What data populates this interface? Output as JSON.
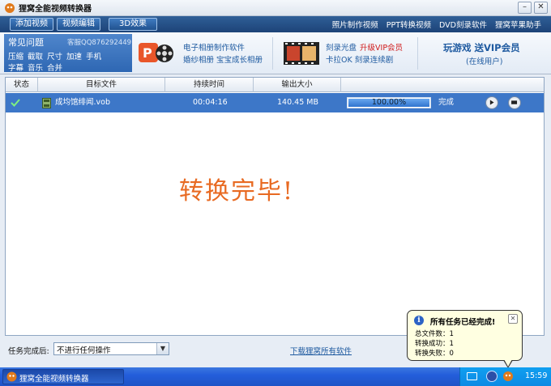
{
  "window": {
    "title": "狸窝全能视频转换器"
  },
  "toolbar": {
    "add_video": "添加视频",
    "edit_video": "视频编辑",
    "effect_3d": "3D效果",
    "links": [
      "照片制作视频",
      "PPT转换视频",
      "DVD刻录软件",
      "狸窝苹果助手"
    ]
  },
  "faq": {
    "title": "常见问题",
    "qq": "客服QQ876292449",
    "links_row1": "压缩 截取 尺寸 加速 手机",
    "links_row2": "字幕 音乐 合并"
  },
  "promos": {
    "p1_line1": "电子相册制作软件",
    "p1_line2": "婚纱相册 宝宝成长相册",
    "p2_line1": "刻录光盘",
    "p2_vip": "升级VIP会员",
    "p2_line2": "卡拉OK 刻录连续剧",
    "p3_line1": "玩游戏 送VIP会员",
    "p3_line2": "(在线用户)"
  },
  "table": {
    "headers": {
      "status": "状态",
      "target": "目标文件",
      "duration": "持续时间",
      "size": "输出大小"
    },
    "rows": [
      {
        "file": "成均馆绯闻.vob",
        "duration": "00:04:16",
        "size": "140.45 MB",
        "progress_label": "100.00%",
        "progress": 1.0,
        "state": "完成"
      }
    ]
  },
  "message": "转换完毕!",
  "bottom": {
    "after_label": "任务完成后:",
    "after_option": "不进行任何操作",
    "download_link": "下载狸窝所有软件"
  },
  "balloon": {
    "title": "所有任务已经完成!",
    "line1": "总文件数：1",
    "line2": "转换成功：1",
    "line3": "转换失败：0"
  },
  "taskbar": {
    "app_label": "狸窝全能视频转换器",
    "time": "15:59"
  },
  "colors": {
    "accent": "#2f67b3",
    "message": "#e86a22",
    "row_selected": "#3d77c8",
    "vip_red": "#d01a1a"
  }
}
